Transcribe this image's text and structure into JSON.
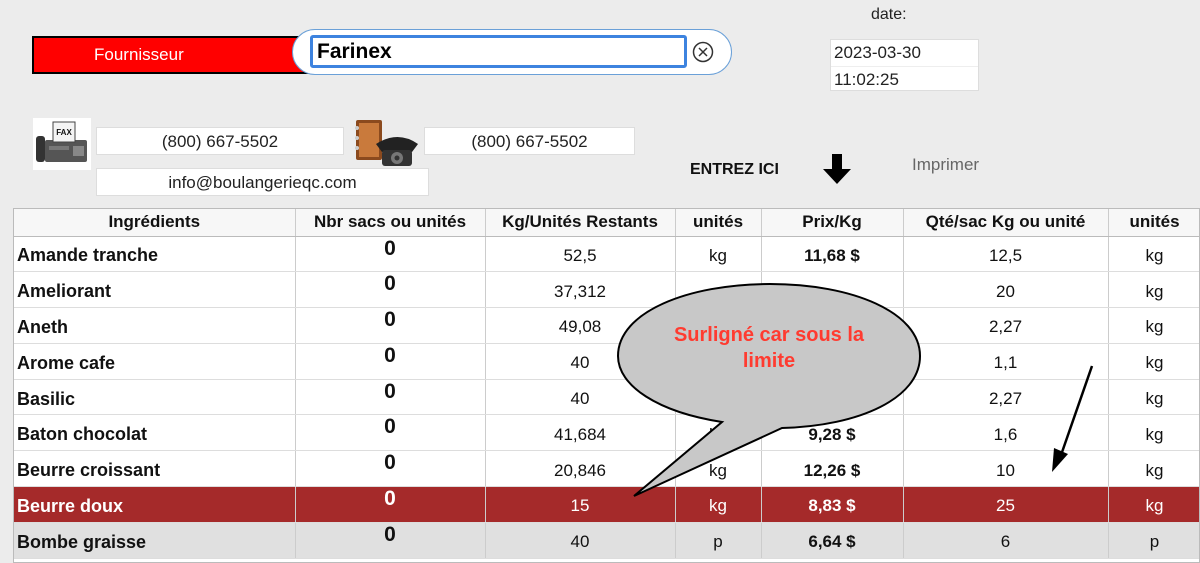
{
  "header": {
    "fournisseur_label": "Fournisseur",
    "search_value": "Farinex",
    "date_label": "date:",
    "date": "2023-03-30",
    "time": "11:02:25"
  },
  "contact": {
    "fax": "(800) 667-5502",
    "phone": "(800) 667-5502",
    "email": "info@boulangerieqc.com"
  },
  "actions": {
    "entrez": "ENTREZ ICI",
    "imprimer": "Imprimer"
  },
  "callout": {
    "line1": "Surligné car sous la",
    "line2": "limite"
  },
  "table": {
    "headers": [
      "Ingrédients",
      "Nbr sacs ou unités",
      "Kg/Unités Restants",
      "unités",
      "Prix/Kg",
      "Qté/sac Kg ou unité",
      "unités"
    ],
    "rows": [
      [
        "Amande tranche",
        "0",
        "52,5",
        "kg",
        "11,68 $",
        "12,5",
        "kg"
      ],
      [
        "Ameliorant",
        "0",
        "37,312",
        "",
        "",
        "20",
        "kg"
      ],
      [
        "Aneth",
        "0",
        "49,08",
        "",
        "",
        "2,27",
        "kg"
      ],
      [
        "Arome cafe",
        "0",
        "40",
        "",
        "",
        "1,1",
        "kg"
      ],
      [
        "Basilic",
        "0",
        "40",
        "",
        "",
        "2,27",
        "kg"
      ],
      [
        "Baton chocolat",
        "0",
        "41,684",
        "kg",
        "9,28 $",
        "1,6",
        "kg"
      ],
      [
        "Beurre croissant",
        "0",
        "20,846",
        "kg",
        "12,26 $",
        "10",
        "kg"
      ],
      [
        "Beurre doux",
        "0",
        "15",
        "kg",
        "8,83 $",
        "25",
        "kg"
      ],
      [
        "Bombe graisse",
        "0",
        "40",
        "p",
        "6,64 $",
        "6",
        "p"
      ]
    ]
  },
  "colors": {
    "alert_row": "#a52a2a",
    "fournisseur_bg": "#ff0000",
    "callout_text": "#ff3b30"
  }
}
